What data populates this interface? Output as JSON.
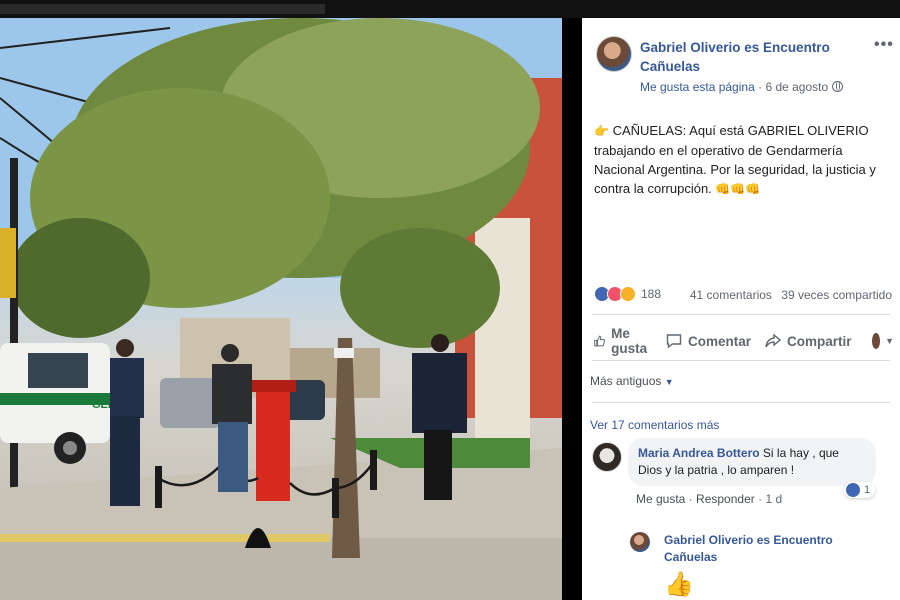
{
  "post": {
    "page_name": "Gabriel Oliverio es Encuentro Cañuelas",
    "more_label": "•••",
    "liked_page": "Me gusta esta página",
    "separator": "·",
    "date": "6 de agosto",
    "text": "CAÑUELAS: Aquí está GABRIEL OLIVERIO trabajando en el operativo de Gendarmería Nacional Argentina. Por la seguridad, la justicia y contra la corrupción.",
    "text_emoji_lead": "👉",
    "text_emoji_tail": "👊👊👊",
    "reactions_count": "188",
    "comments_count": "41 comentarios",
    "shares_count": "39 veces compartido"
  },
  "actions": {
    "like": "Me gusta",
    "comment": "Comentar",
    "share": "Compartir"
  },
  "comments": {
    "sort_label": "Más antiguos",
    "show_more": "Ver 17 comentarios más",
    "items": [
      {
        "author": "Maria Andrea Bottero",
        "text": "Si la hay , que Dios y la patria , lo amparen !",
        "like_label": "Me gusta",
        "dot": "·",
        "reply_label": "Responder",
        "time": "1 d",
        "likes": "1"
      }
    ],
    "reply": {
      "author": "Gabriel Oliverio es Encuentro Cañuelas",
      "emoji": "👍"
    }
  },
  "photo": {
    "vehicle_text": "GEND"
  },
  "colors": {
    "link": "#365899",
    "meta": "#606770",
    "like_blue": "#4267b2",
    "love_red": "#f25268",
    "haha_yellow": "#f7b125"
  }
}
